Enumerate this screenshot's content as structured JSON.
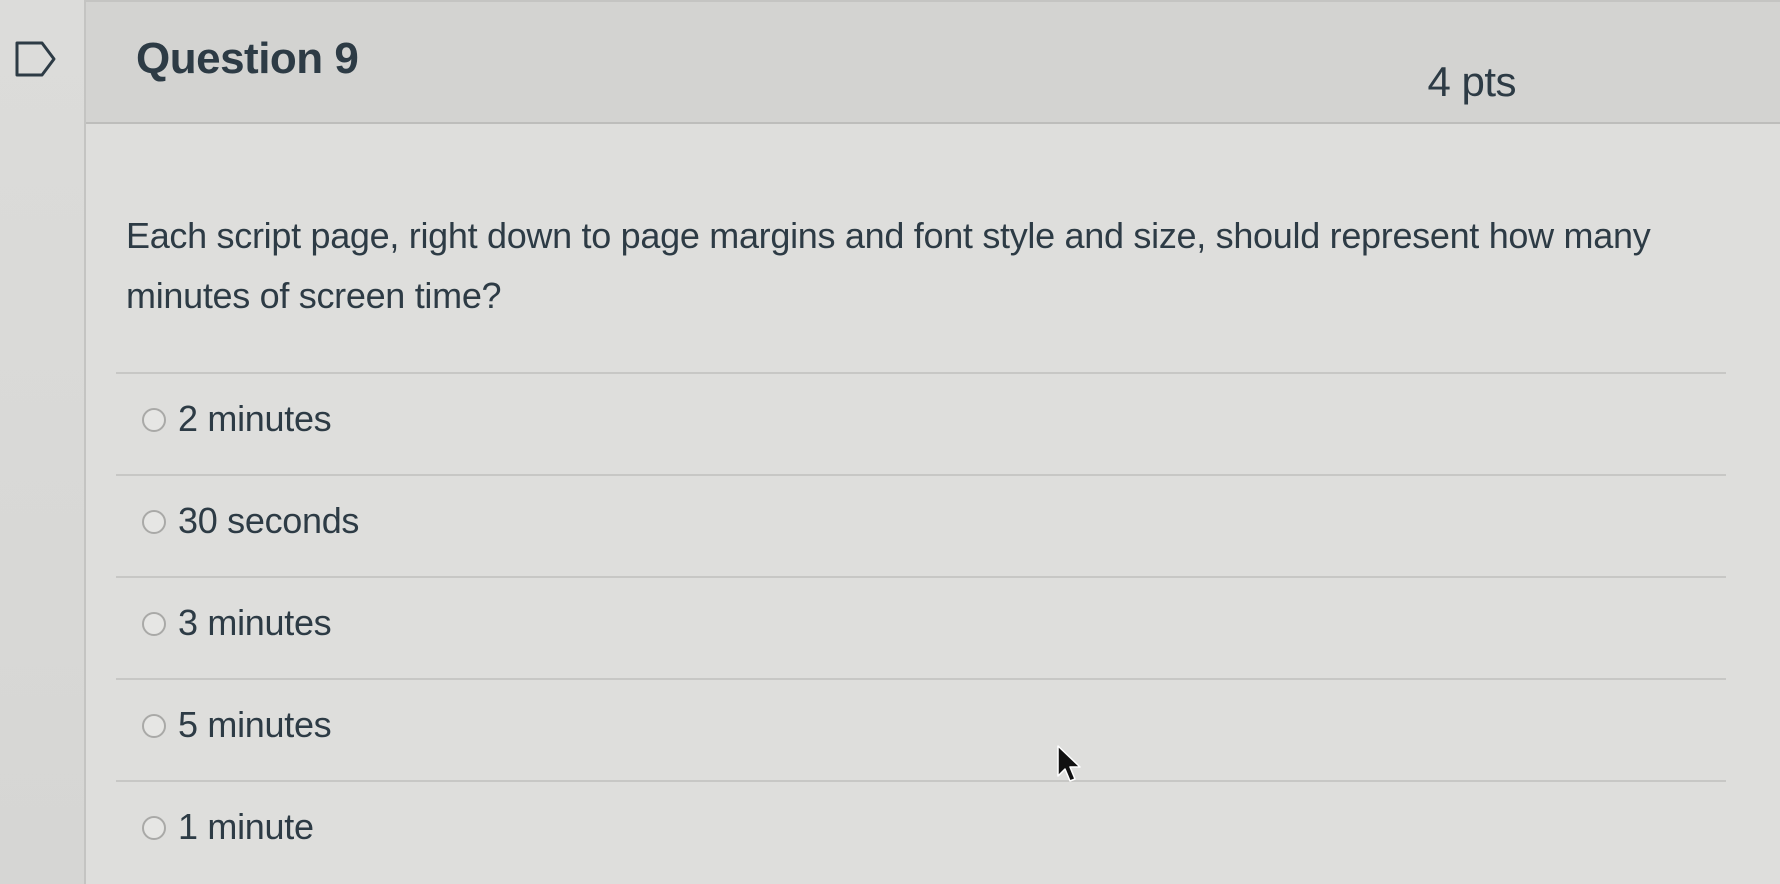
{
  "question": {
    "title": "Question 9",
    "points": "4 pts",
    "text": "Each script page, right down to page margins and font style and size, should represent how many minutes of screen time?"
  },
  "answers": [
    {
      "label": "2 minutes",
      "selected": false
    },
    {
      "label": "30 seconds",
      "selected": false
    },
    {
      "label": "3 minutes",
      "selected": false
    },
    {
      "label": "5 minutes",
      "selected": false
    },
    {
      "label": "1 minute",
      "selected": false
    }
  ],
  "icons": {
    "flag": "flag-question-icon",
    "cursor": "mouse-pointer-icon"
  }
}
